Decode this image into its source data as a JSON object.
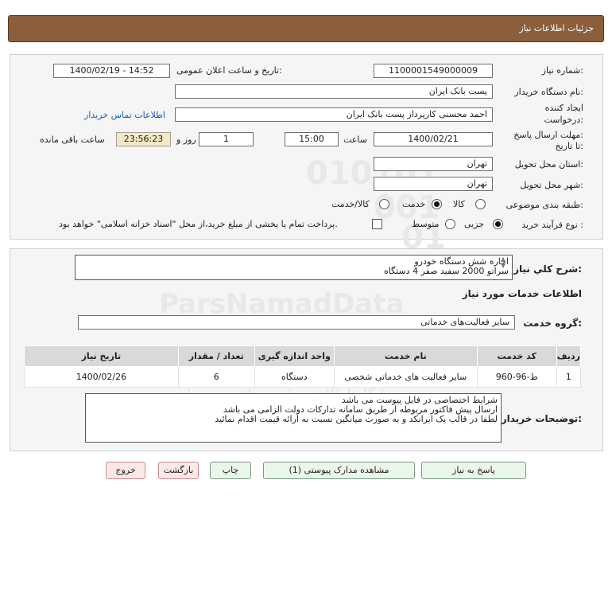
{
  "header": {
    "title": "جزئیات اطلاعات نیاز"
  },
  "info": {
    "need_number_label": "شماره نیاز:",
    "need_number": "1100001549000009",
    "announce_label": "تاریخ و ساعت اعلان عمومی:",
    "announce_value": "1400/02/19 - 14:52",
    "buyer_org_label": "نام دستگاه خریدار:",
    "buyer_org": "پست بانک ایران",
    "creator_label_1": "ایجاد کننده",
    "creator_label_2": "درخواست:",
    "creator": "احمد  محسنی کارپرداز پست بانک ایران",
    "contact_link": "اطلاعات تماس خریدار",
    "deadline_label_1": "مهلت ارسال پاسخ:",
    "deadline_label_2": "تا تاریخ:",
    "deadline_date": "1400/02/21",
    "time_label": "ساعت",
    "deadline_time": "15:00",
    "days": "1",
    "days_label": "روز و",
    "remaining": "23:56:23",
    "remaining_label": "ساعت باقی مانده",
    "province_label": "استان محل تحویل:",
    "province": "تهران",
    "city_label": "شهر محل تحویل:",
    "city": "تهران",
    "category_label": "طبقه بندی موضوعی:",
    "category_options": [
      "کالا",
      "خدمت",
      "کالا/خدمت"
    ],
    "category_selected": "خدمت",
    "process_label": "نوع فرآیند خرید :",
    "process_options": [
      "جزیی",
      "متوسط"
    ],
    "process_selected": "جزیی",
    "payment_note": "پرداخت تمام یا بخشی از مبلغ خرید،از محل \"اسناد خزانه اسلامی\" خواهد بود."
  },
  "summary": {
    "label": "شرح کلي نياز:",
    "line1": "اجاره شش دستگاه خودرو",
    "line2": "سراتو 2000 سفید صفر 4 دستگاه"
  },
  "services": {
    "section_title": "اطلاعات خدمات مورد نیاز",
    "group_label": "گروه خدمت:",
    "group_value": "سایر فعالیت‌های خدماتی",
    "columns": [
      "ردیف",
      "کد خدمت",
      "نام خدمت",
      "واحد اندازه گیری",
      "تعداد / مقدار",
      "تاریخ نیاز"
    ],
    "rows": [
      [
        "1",
        "ط-96-960",
        "سایر فعالیت های خدماتی شخصی",
        "دستگاه",
        "6",
        "1400/02/26"
      ]
    ]
  },
  "buyer_notes": {
    "label": "توضیحات خریدار:",
    "lines": [
      "شرایط اختصاصی در فایل پیوست می باشد",
      "ارسال پیش فاکتور مربوطه از طریق سامانه تدارکات دولت الزامی می باشد",
      "لطفا در قالب یک ایرانکد و به صورت میانگین نسبت به ارائه قیمت اقدام نمائید"
    ]
  },
  "buttons": {
    "reply": "پاسخ به نیاز",
    "attachments": "مشاهده مدارک پیوستی (1)",
    "print": "چاپ",
    "back": "بازگشت",
    "exit": "خروج"
  },
  "watermark": {
    "brand": "ParsNamadData",
    "digits_1": "010101",
    "digits_2": "001",
    "digits_3": "01",
    "fa_1": "مرکز فراوری اطلاعات پارس نماد داده",
    "fa_2": "پایگاه اطلاع رسانی مناقصه ومزایده"
  },
  "colors": {
    "header_bg": "#8b5e3c",
    "timer_bg": "#f4e9c6",
    "link": "#1a5fb4"
  }
}
